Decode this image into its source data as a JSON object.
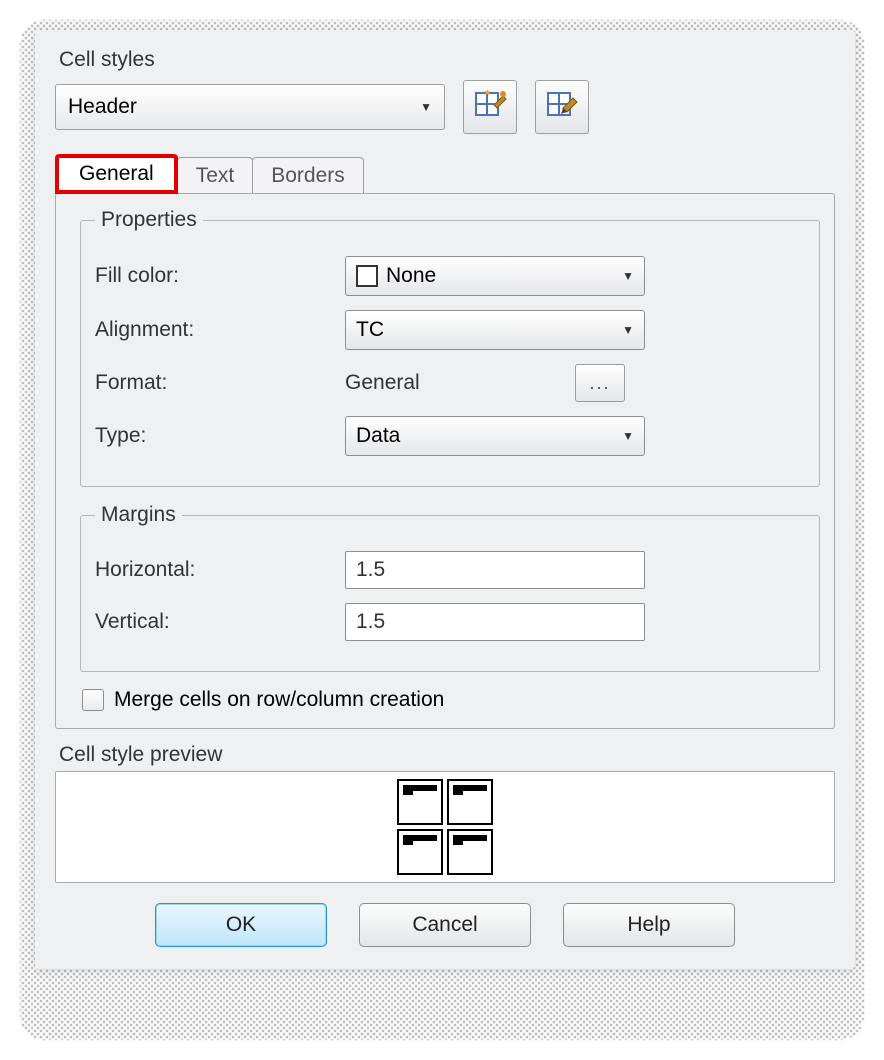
{
  "header": {
    "cell_styles_label": "Cell styles",
    "selected_style": "Header"
  },
  "tabs": {
    "general": "General",
    "text": "Text",
    "borders": "Borders"
  },
  "properties": {
    "legend": "Properties",
    "fill_color_label": "Fill color:",
    "fill_color_value": "None",
    "alignment_label": "Alignment:",
    "alignment_value": "TC",
    "format_label": "Format:",
    "format_value": "General",
    "format_button": "...",
    "type_label": "Type:",
    "type_value": "Data"
  },
  "margins": {
    "legend": "Margins",
    "horizontal_label": "Horizontal:",
    "horizontal_value": "1.5",
    "vertical_label": "Vertical:",
    "vertical_value": "1.5"
  },
  "merge_checkbox_label": "Merge cells on row/column creation",
  "preview_label": "Cell style preview",
  "buttons": {
    "ok": "OK",
    "cancel": "Cancel",
    "help": "Help"
  },
  "icons": {
    "new_style": "new-cell-style-icon",
    "edit_style": "edit-cell-style-icon"
  }
}
